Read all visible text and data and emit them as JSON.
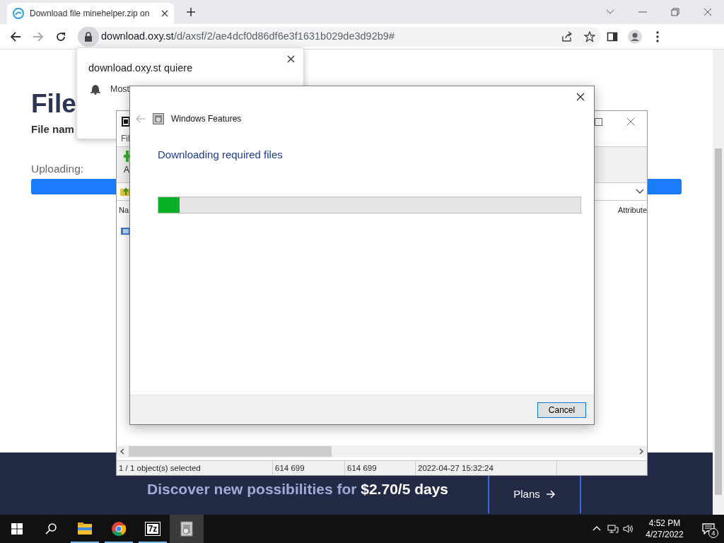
{
  "browser": {
    "tab_title": "Download file minehelper.zip on",
    "url_host": "download.oxy.st",
    "url_path": "/d/axsf/2/ae4dcf0d86df6e3f1631b029de3d92b9#"
  },
  "page": {
    "heading": "File",
    "file_name_label": "File nam",
    "upload_label": "Uploading:",
    "level": 1,
    "promo": "Discover new possibilities for **$2.70/5 days**",
    "plans_button": "Plans"
  },
  "notification": {
    "title": "download.oxy.st quiere",
    "line": "Most"
  },
  "archive_window": {
    "menu_partial": "Fil",
    "toolbar_partial": "A",
    "columns": [
      "Na",
      "Attribute"
    ],
    "status": [
      "1 / 1 object(s) selected",
      "614 699",
      "614 699",
      "2022-04-27 15:32:24"
    ]
  },
  "dialog": {
    "title": "Windows Features",
    "heading": "Downloading required files",
    "level": 0.05,
    "buttons": [
      "Cancel"
    ]
  },
  "taskbar": {
    "apps": [
      {
        "kind": "explorer",
        "selected": false
      },
      {
        "kind": "chrome",
        "selected": false
      },
      {
        "kind": "sevenzip",
        "label": "7z",
        "selected": false
      },
      {
        "kind": "features",
        "selected": true
      }
    ],
    "time": "4:52 PM",
    "date": "4/27/2022",
    "notification_count": "4"
  }
}
